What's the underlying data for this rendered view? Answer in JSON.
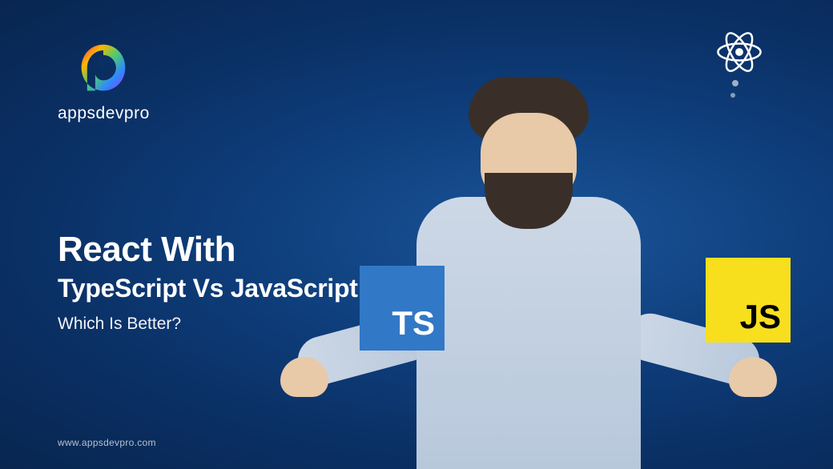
{
  "brand": {
    "name": "appsdevpro",
    "url": "www.appsdevpro.com"
  },
  "headline": {
    "line1": "React With",
    "line2": "TypeScript Vs JavaScript:",
    "line3": "Which Is Better?"
  },
  "badges": {
    "typescript": "TS",
    "javascript": "JS"
  },
  "colors": {
    "typescript_bg": "#3178c6",
    "javascript_bg": "#f7df1e",
    "background_gradient_start": "#1a5599",
    "background_gradient_end": "#082650"
  },
  "icons": {
    "react": "react-logo",
    "brand_mark": "appsdevpro-logo"
  }
}
